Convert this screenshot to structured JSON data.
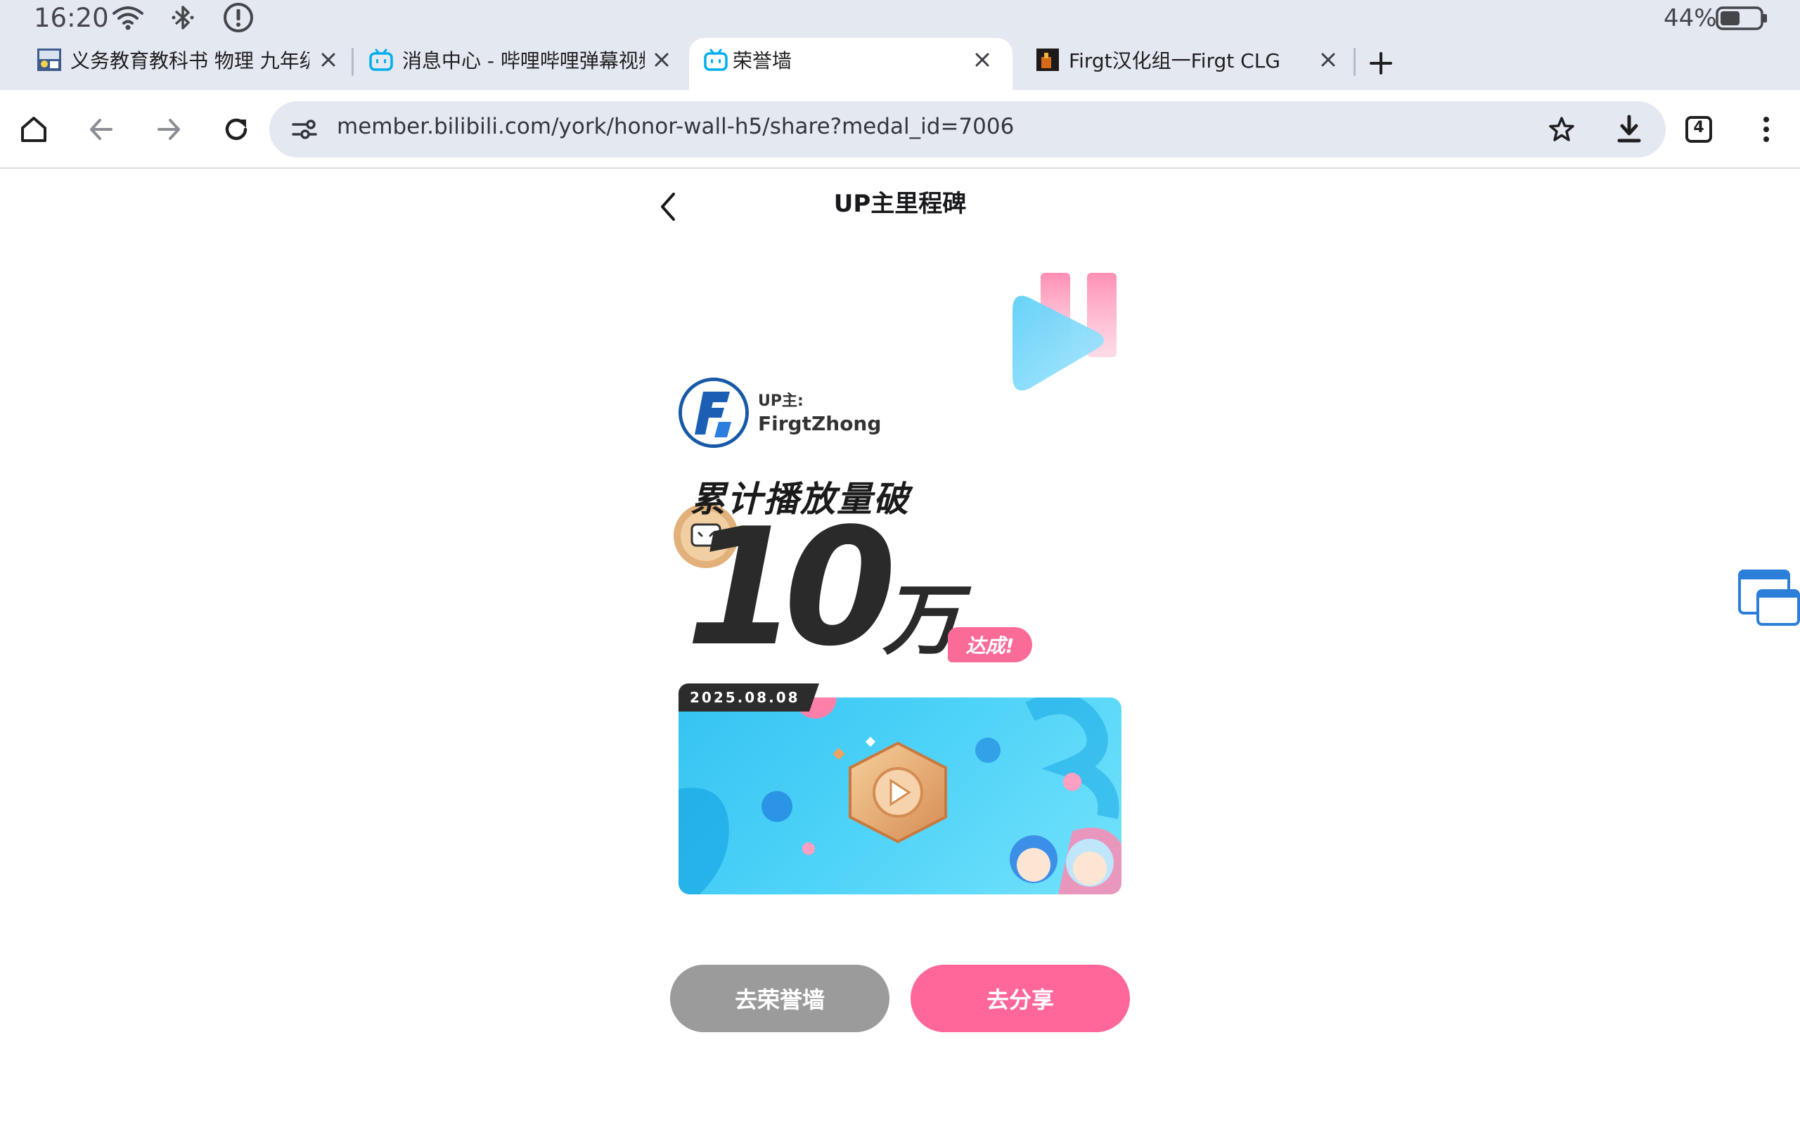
{
  "status_bar": {
    "time": "16:20",
    "battery_percent": "44%",
    "battery_level": 0.44,
    "icons": [
      "wifi-icon",
      "bluetooth-icon",
      "alert-icon",
      "battery-icon"
    ]
  },
  "tabs": [
    {
      "title": "义务教育教科书 物理 九年级",
      "favicon": "textbook-favicon",
      "active": false
    },
    {
      "title": "消息中心 - 哔哩哔哩弹幕视频",
      "favicon": "bilibili-favicon",
      "active": false
    },
    {
      "title": "荣誉墙",
      "favicon": "bilibili-favicon",
      "active": true
    },
    {
      "title": "Firgt汉化组一Firgt CLG",
      "favicon": "firgt-favicon",
      "active": false
    }
  ],
  "toolbar": {
    "url": "member.bilibili.com/york/honor-wall-h5/share?medal_id=7006",
    "tab_count": "4"
  },
  "page": {
    "title": "UP主里程碑",
    "up_label": "UP主:",
    "up_name": "FirgtZhong",
    "headline": "累计播放量破",
    "number": "10",
    "unit": "万",
    "achieved": "达成!",
    "date": "2025.08.08",
    "buttons": {
      "honor_wall": "去荣誉墙",
      "share": "去分享"
    }
  },
  "colors": {
    "accent_pink": "#ff6699",
    "grey_button": "#9b9b9b",
    "chrome_bg": "#e4e8f1",
    "bilibili_blue": "#00aeec"
  }
}
